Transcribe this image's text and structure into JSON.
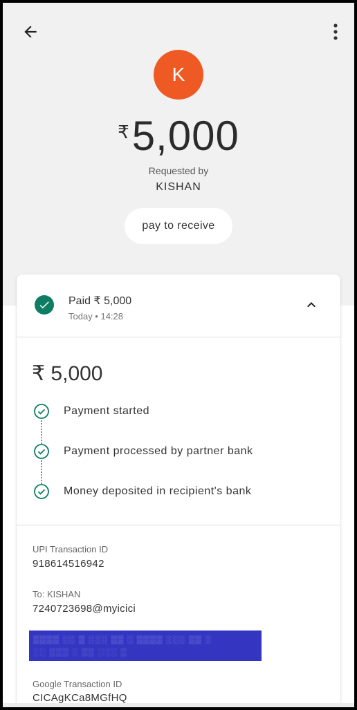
{
  "header": {
    "back_icon": "arrow-left-icon",
    "more_icon": "more-vertical-icon"
  },
  "avatar": {
    "initial": "K",
    "color": "#ef5a24"
  },
  "request": {
    "currency_symbol": "₹",
    "amount": "5,000",
    "requested_by_label": "Requested by",
    "requester_name": "KISHAN",
    "note": "pay to receive"
  },
  "card": {
    "status_icon": "check-circle-icon",
    "status_color": "#0f7d63",
    "status_title": "Paid ₹ 5,000",
    "status_time": "Today • 14:28",
    "collapse_icon": "chevron-up-icon",
    "amount_display": "₹ 5,000",
    "steps": [
      {
        "label": "Payment started",
        "icon": "check-outline-icon"
      },
      {
        "label": "Payment processed by partner bank",
        "icon": "check-outline-icon"
      },
      {
        "label": "Money deposited in recipient's bank",
        "icon": "check-outline-icon"
      }
    ],
    "details": {
      "upi_label": "UPI Transaction ID",
      "upi_value": "918614516942",
      "to_label": "To: KISHAN",
      "to_value": "7240723698@myicici",
      "google_label": "Google Transaction ID",
      "google_value": "CICAgKCa8MGfHQ"
    }
  }
}
